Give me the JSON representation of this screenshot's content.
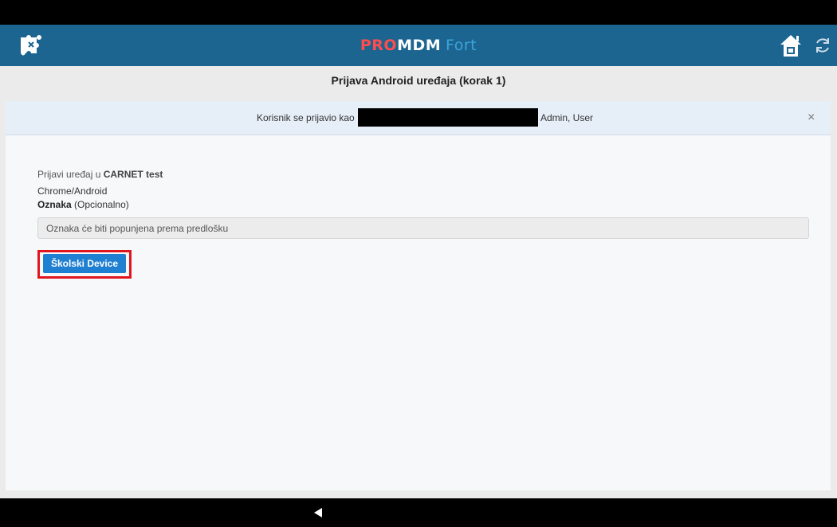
{
  "app_bar": {
    "brand_pro": "PRO",
    "brand_mdm": "MDM",
    "brand_fort": "Fort"
  },
  "page": {
    "title": "Prijava Android uređaja (korak 1)"
  },
  "alert": {
    "text_before": "Korisnik se prijavio kao",
    "text_after": "Admin, User",
    "close_symbol": "×"
  },
  "form": {
    "heading_prefix": "Prijavi uređaj u",
    "heading_org": "CARNET test",
    "platform": "Chrome/Android",
    "label_name": "Oznaka",
    "label_optional": "(Opcionalno)",
    "tag_placeholder": "Oznaka će biti popunjena prema predlošku",
    "device_button": "Školski Device"
  },
  "icons": {
    "app_logo": "puzzle-logo-icon",
    "home": "home-icon",
    "refresh": "refresh-icon",
    "back": "back-triangle-icon",
    "close": "close-icon"
  },
  "colors": {
    "app_bar": "#1b6590",
    "brand_pro": "#ff4d4d",
    "brand_fort": "#3fa3dd",
    "primary_button": "#1f7fd1",
    "highlight": "#e0161e",
    "alert_bg": "#e6eef7"
  }
}
